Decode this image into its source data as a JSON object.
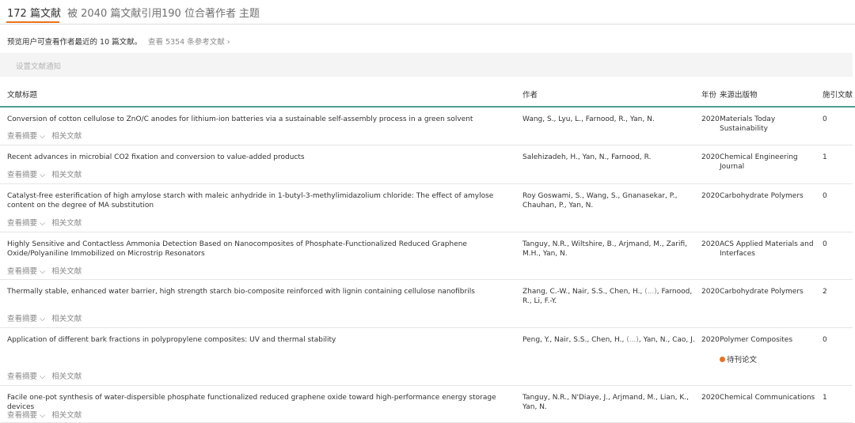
{
  "tabs": [
    {
      "label": "172 篇文献"
    },
    {
      "label": "被 2040 篇文献引用"
    },
    {
      "label": "190 位合著作者"
    },
    {
      "label": "主题"
    }
  ],
  "info": {
    "text": "预览用户可查看作者最近的 10 篇文献。",
    "link": "查看 5354 条参考文献 ›"
  },
  "alert": {
    "label": "设置文献通知"
  },
  "table": {
    "headers": {
      "title": "文献标题",
      "authors": "作者",
      "year": "年份",
      "source": "来源出版物",
      "cited": "施引文献"
    },
    "actions": {
      "abstract": "查看摘要 ⌵",
      "related": "相关文献"
    },
    "rows": [
      {
        "title": "Conversion of cotton cellulose to ZnO/C anodes for lithium-ion batteries via a sustainable self-assembly process in a green solvent",
        "authors": "Wang, S., Lyu, L., Farnood, R., Yan, N.",
        "year": "2020",
        "source": "Materials Today Sustainability",
        "cited": "0"
      },
      {
        "title": "Recent advances in microbial CO2 fixation and conversion to value-added products",
        "authors": "Salehizadeh, H., Yan, N., Farnood, R.",
        "year": "2020",
        "source": "Chemical Engineering Journal",
        "cited": "1"
      },
      {
        "title": "Catalyst-free esterification of high amylose starch with maleic anhydride in 1-butyl-3-methylimidazolium chloride: The effect of amylose content on the degree of MA substitution",
        "authors": "Roy Goswami, S., Wang, S., Gnanasekar, P., Chauhan, P., Yan, N.",
        "year": "2020",
        "source": "Carbohydrate Polymers",
        "cited": "0"
      },
      {
        "title": "Highly Sensitive and Contactless Ammonia Detection Based on Nanocomposites of Phosphate-Functionalized Reduced Graphene Oxide/Polyaniline Immobilized on Microstrip Resonators",
        "authors": "Tanguy, N.R., Wiltshire, B., Arjmand, M., Zarifi, M.H., Yan, N.",
        "year": "2020",
        "source": "ACS Applied Materials and Interfaces",
        "cited": "0"
      },
      {
        "title": "Thermally stable, enhanced water barrier, high strength starch bio-composite reinforced with lignin containing cellulose nanofibrils",
        "authors_a": "Zhang, C.-W., Nair, S.S., Chen, H., ",
        "authors_etal": "(...)",
        "authors_b": ", Farnood, R., Li, F.-Y.",
        "year": "2020",
        "source": "Carbohydrate Polymers",
        "cited": "2"
      },
      {
        "title": "Application of different bark fractions in polypropylene composites: UV and thermal stability",
        "authors_a": "Peng, Y., Nair, S.S., Chen, H., ",
        "authors_etal": "(...)",
        "authors_b": ", Yan, N., Cao, J.",
        "year": "2020",
        "source": "Polymer Composites",
        "cited": "0",
        "badge": "待刊论文"
      },
      {
        "title": "Facile one-pot synthesis of water-dispersible phosphate functionalized reduced graphene oxide toward high-performance energy storage devices",
        "authors": "Tanguy, N.R., N'Diaye, J., Arjmand, M., Lian, K., Yan, N.",
        "year": "2020",
        "source": "Chemical Communications",
        "cited": "1"
      }
    ]
  },
  "colors": {
    "accent": "#e9711c",
    "header_rule": "#4d9e93"
  }
}
